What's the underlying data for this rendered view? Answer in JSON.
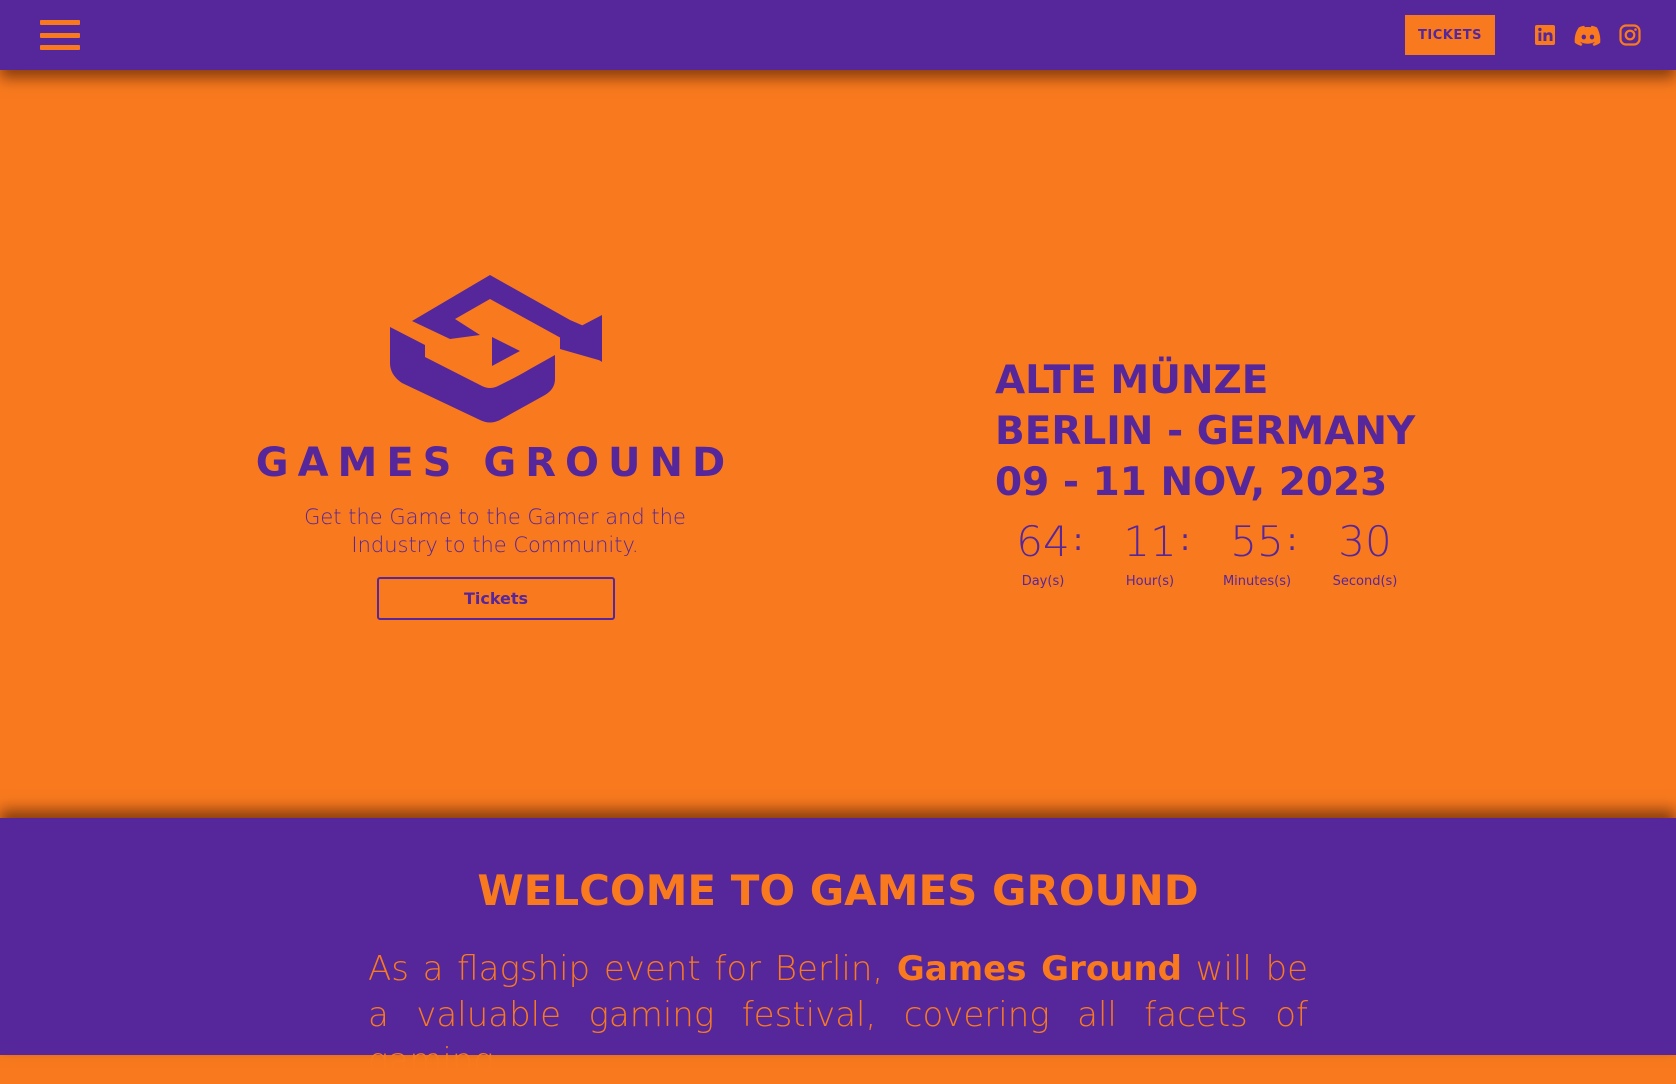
{
  "colors": {
    "purple": "#56279b",
    "orange": "#f97a1e"
  },
  "header": {
    "menu_icon": "hamburger-menu-icon",
    "tickets_label": "TICKETS",
    "social": [
      {
        "name": "linkedin",
        "icon": "linkedin-icon"
      },
      {
        "name": "discord",
        "icon": "discord-icon"
      },
      {
        "name": "instagram",
        "icon": "instagram-icon"
      }
    ]
  },
  "hero": {
    "logo_icon": "games-ground-logo-icon",
    "brand_name": "GAMES GROUND",
    "tagline": "Get the Game to the Gamer and the Industry to the Community.",
    "tickets_label": "Tickets",
    "venue_line1": "ALTE MÜNZE",
    "venue_line2": "BERLIN - GERMANY",
    "venue_line3": "09 - 11 NOV, 2023",
    "countdown": {
      "days": "64",
      "hours": "11",
      "minutes": "55",
      "seconds": "30",
      "days_label": "Day(s)",
      "hours_label": "Hour(s)",
      "minutes_label": "Minutes(s)",
      "seconds_label": "Second(s)",
      "separator": ":"
    }
  },
  "welcome": {
    "title": "WELCOME TO GAMES GROUND",
    "body_before": "As a flagship event for Berlin, ",
    "body_bold": "Games Ground",
    "body_after": " will be a valuable gaming festival, covering all facets of gaming"
  }
}
